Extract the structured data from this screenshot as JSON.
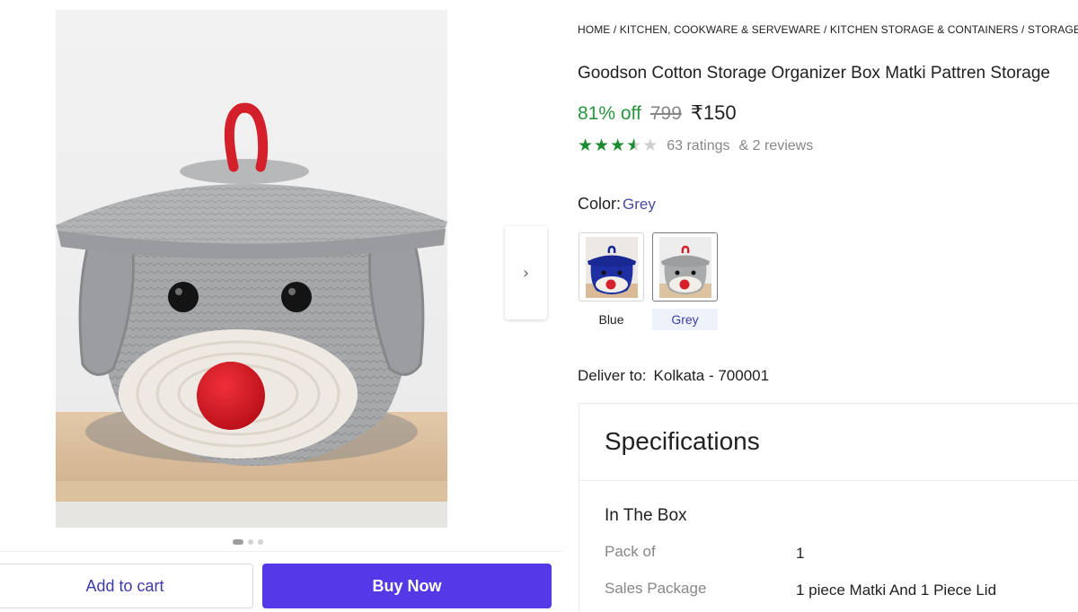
{
  "breadcrumb": [
    "HOME",
    "KITCHEN, COOKWARE & SERVEWARE",
    "KITCHEN STORAGE & CONTAINERS",
    "STORAGE BA"
  ],
  "product": {
    "title": "Goodson Cotton Storage Organizer Box Matki Pattren Storage",
    "discount": "81% off",
    "mrp": "799",
    "price": "₹150",
    "rating_value": 3.5,
    "ratings_text": "63 ratings",
    "reviews_text": "& 2 reviews"
  },
  "color": {
    "label": "Color:",
    "selected": "Grey",
    "options": [
      {
        "name": "Blue",
        "swatch_color": "#1d2fa3"
      },
      {
        "name": "Grey",
        "swatch_color": "#a9aaab"
      }
    ]
  },
  "delivery": {
    "label": "Deliver to:",
    "location": "Kolkata - 700001"
  },
  "specifications": {
    "title": "Specifications",
    "section": "In The Box",
    "rows": [
      {
        "key": "Pack of",
        "value": "1"
      },
      {
        "key": "Sales Package",
        "value": "1 piece Matki And 1 Piece Lid"
      }
    ]
  },
  "gallery": {
    "total_images": 3,
    "active_index": 0,
    "next_icon": "chevron-right-icon"
  },
  "actions": {
    "add_to_cart": "Add to cart",
    "buy_now": "Buy Now"
  },
  "colors": {
    "accent": "#5539e6",
    "discount_green": "#2b9440",
    "star_green": "#1b8a30"
  }
}
